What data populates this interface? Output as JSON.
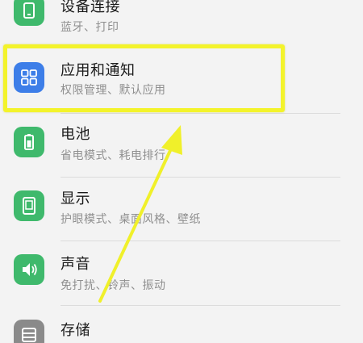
{
  "settings_list": {
    "items": [
      {
        "title": "设备连接",
        "subtitle": "蓝牙、打印",
        "icon": "device-connection-icon",
        "icon_color": "#3fb96c"
      },
      {
        "title": "应用和通知",
        "subtitle": "权限管理、默认应用",
        "icon": "apps-grid-icon",
        "icon_color": "#3d7ee8"
      },
      {
        "title": "电池",
        "subtitle": "省电模式、耗电排行",
        "icon": "battery-icon",
        "icon_color": "#3fb96c"
      },
      {
        "title": "显示",
        "subtitle": "护眼模式、桌面风格、壁纸",
        "icon": "display-icon",
        "icon_color": "#3fb96c"
      },
      {
        "title": "声音",
        "subtitle": "免打扰、铃声、振动",
        "icon": "speaker-icon",
        "icon_color": "#3fb96c"
      },
      {
        "title": "存储",
        "subtitle": "",
        "icon": "storage-icon",
        "icon_color": "#8a8a8a"
      }
    ]
  },
  "annotation": {
    "highlight_color": "#f3f32b",
    "arrow_color": "#f0f02a"
  }
}
